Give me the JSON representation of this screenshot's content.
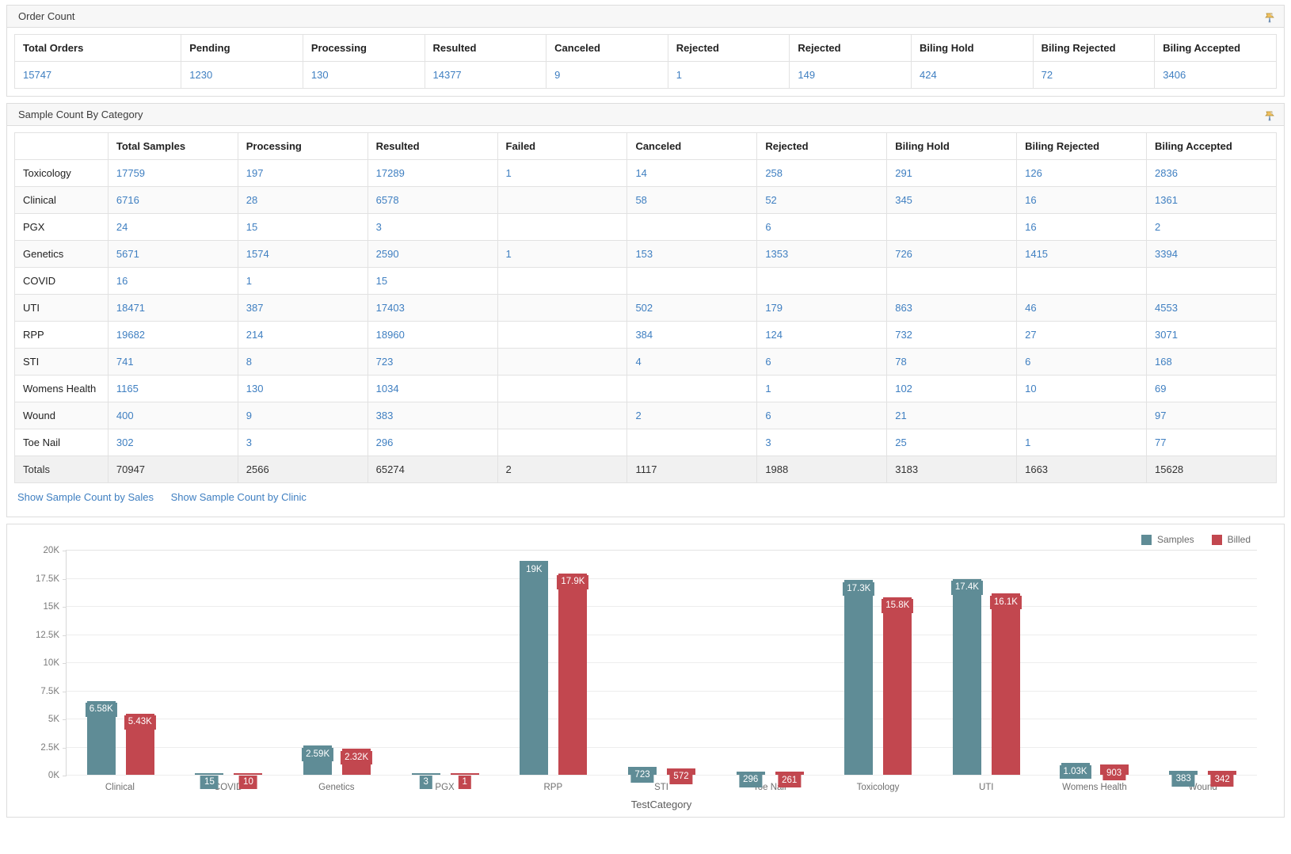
{
  "order_count": {
    "panel_title": "Order Count",
    "pin_icon": "pushpin-icon",
    "headers": [
      "Total Orders",
      "Pending",
      "Processing",
      "Resulted",
      "Canceled",
      "Rejected",
      "Rejected",
      "Biling Hold",
      "Biling Rejected",
      "Biling Accepted"
    ],
    "values": [
      "15747",
      "1230",
      "130",
      "14377",
      "9",
      "1",
      "149",
      "424",
      "72",
      "3406"
    ]
  },
  "sample_count": {
    "panel_title": "Sample Count By Category",
    "pin_icon": "pushpin-icon",
    "headers": [
      "",
      "Total Samples",
      "Processing",
      "Resulted",
      "Failed",
      "Canceled",
      "Rejected",
      "Biling Hold",
      "Biling Rejected",
      "Biling Accepted"
    ],
    "rows": [
      {
        "label": "Toxicology",
        "cells": [
          "17759",
          "197",
          "17289",
          "1",
          "14",
          "258",
          "291",
          "126",
          "2836"
        ]
      },
      {
        "label": "Clinical",
        "cells": [
          "6716",
          "28",
          "6578",
          "",
          "58",
          "52",
          "345",
          "16",
          "1361"
        ]
      },
      {
        "label": "PGX",
        "cells": [
          "24",
          "15",
          "3",
          "",
          "",
          "6",
          "",
          "16",
          "2"
        ]
      },
      {
        "label": "Genetics",
        "cells": [
          "5671",
          "1574",
          "2590",
          "1",
          "153",
          "1353",
          "726",
          "1415",
          "3394"
        ]
      },
      {
        "label": "COVID",
        "cells": [
          "16",
          "1",
          "15",
          "",
          "",
          "",
          "",
          "",
          ""
        ]
      },
      {
        "label": "UTI",
        "cells": [
          "18471",
          "387",
          "17403",
          "",
          "502",
          "179",
          "863",
          "46",
          "4553"
        ]
      },
      {
        "label": "RPP",
        "cells": [
          "19682",
          "214",
          "18960",
          "",
          "384",
          "124",
          "732",
          "27",
          "3071"
        ]
      },
      {
        "label": "STI",
        "cells": [
          "741",
          "8",
          "723",
          "",
          "4",
          "6",
          "78",
          "6",
          "168"
        ]
      },
      {
        "label": "Womens Health",
        "cells": [
          "1165",
          "130",
          "1034",
          "",
          "",
          "1",
          "102",
          "10",
          "69"
        ]
      },
      {
        "label": "Wound",
        "cells": [
          "400",
          "9",
          "383",
          "",
          "2",
          "6",
          "21",
          "",
          "97"
        ]
      },
      {
        "label": "Toe Nail",
        "cells": [
          "302",
          "3",
          "296",
          "",
          "",
          "3",
          "25",
          "1",
          "77"
        ]
      }
    ],
    "totals": {
      "label": "Totals",
      "cells": [
        "70947",
        "2566",
        "65274",
        "2",
        "1117",
        "1988",
        "3183",
        "1663",
        "15628"
      ]
    },
    "links": [
      {
        "label": "Show Sample Count by Sales"
      },
      {
        "label": "Show Sample Count by Clinic"
      }
    ]
  },
  "chart_data": {
    "type": "bar",
    "title": "",
    "xlabel": "TestCategory",
    "ylabel": "",
    "ylim": [
      0,
      20000
    ],
    "ytick_values": [
      0,
      2500,
      5000,
      7500,
      10000,
      12500,
      15000,
      17500,
      20000
    ],
    "ytick_labels": [
      "0K",
      "2.5K",
      "5K",
      "7.5K",
      "10K",
      "12.5K",
      "15K",
      "17.5K",
      "20K"
    ],
    "grid": true,
    "legend_position": "top-right",
    "categories": [
      "Clinical",
      "COVID",
      "Genetics",
      "PGX",
      "RPP",
      "STI",
      "Toe Nail",
      "Toxicology",
      "UTI",
      "Womens Health",
      "Wound"
    ],
    "series": [
      {
        "name": "Samples",
        "color": "#5f8c96",
        "values": [
          6580,
          15,
          2590,
          3,
          19000,
          723,
          296,
          17300,
          17400,
          1030,
          383
        ],
        "labels": [
          "6.58K",
          "15",
          "2.59K",
          "3",
          "19K",
          "723",
          "296",
          "17.3K",
          "17.4K",
          "1.03K",
          "383"
        ]
      },
      {
        "name": "Billed",
        "color": "#c2474f",
        "values": [
          5430,
          10,
          2320,
          1,
          17900,
          572,
          261,
          15800,
          16100,
          903,
          342
        ],
        "labels": [
          "5.43K",
          "10",
          "2.32K",
          "1",
          "17.9K",
          "572",
          "261",
          "15.8K",
          "16.1K",
          "903",
          "342"
        ]
      }
    ]
  }
}
